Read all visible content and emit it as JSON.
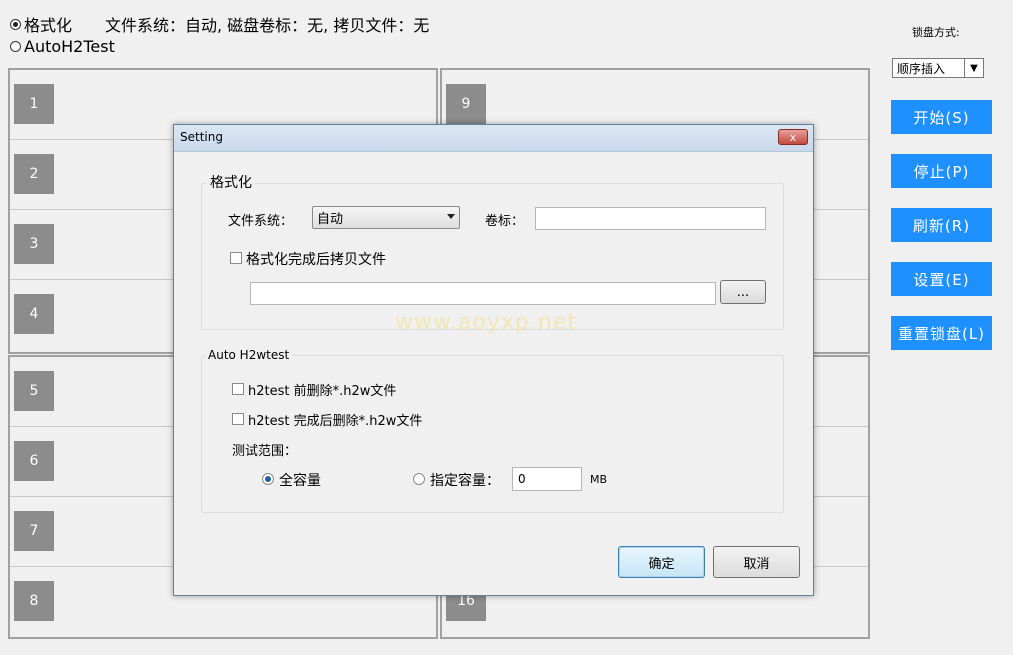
{
  "modes": {
    "format_label": "格式化",
    "format_summary": "文件系统：自动, 磁盘卷标：无, 拷贝文件：无",
    "autoh2test_label": "AutoH2Test"
  },
  "slots_left_top": [
    "1",
    "2",
    "3",
    "4"
  ],
  "slots_left_bottom": [
    "5",
    "6",
    "7",
    "8"
  ],
  "slots_right_top": [
    "9"
  ],
  "slots_right_bottom": [
    "16"
  ],
  "sidebar": {
    "lock_label": "锁盘方式:",
    "lock_mode": "顺序插入",
    "start": "开始(S)",
    "stop": "停止(P)",
    "refresh": "刷新(R)",
    "settings": "设置(E)",
    "reset_lock": "重置锁盘(L)"
  },
  "dialog": {
    "title": "Setting",
    "close": "x",
    "format_group": "格式化",
    "fs_label": "文件系统：",
    "fs_value": "自动",
    "volume_label": "卷标：",
    "volume_value": "",
    "copy_after_format": "格式化完成后拷贝文件",
    "copy_path": "",
    "browse": "...",
    "h2_group": "Auto H2wtest",
    "delete_before": "h2test 前删除*.h2w文件",
    "delete_after": "h2test 完成后删除*.h2w文件",
    "range_label": "测试范围：",
    "full_capacity": "全容量",
    "specified_capacity": "指定容量：",
    "capacity_value": "0",
    "unit": "MB",
    "ok": "确定",
    "cancel": "取消"
  },
  "watermark": "www.aoyxp.net",
  "colors": {
    "accent": "#1e90ff",
    "slot": "#8c8c8c"
  }
}
